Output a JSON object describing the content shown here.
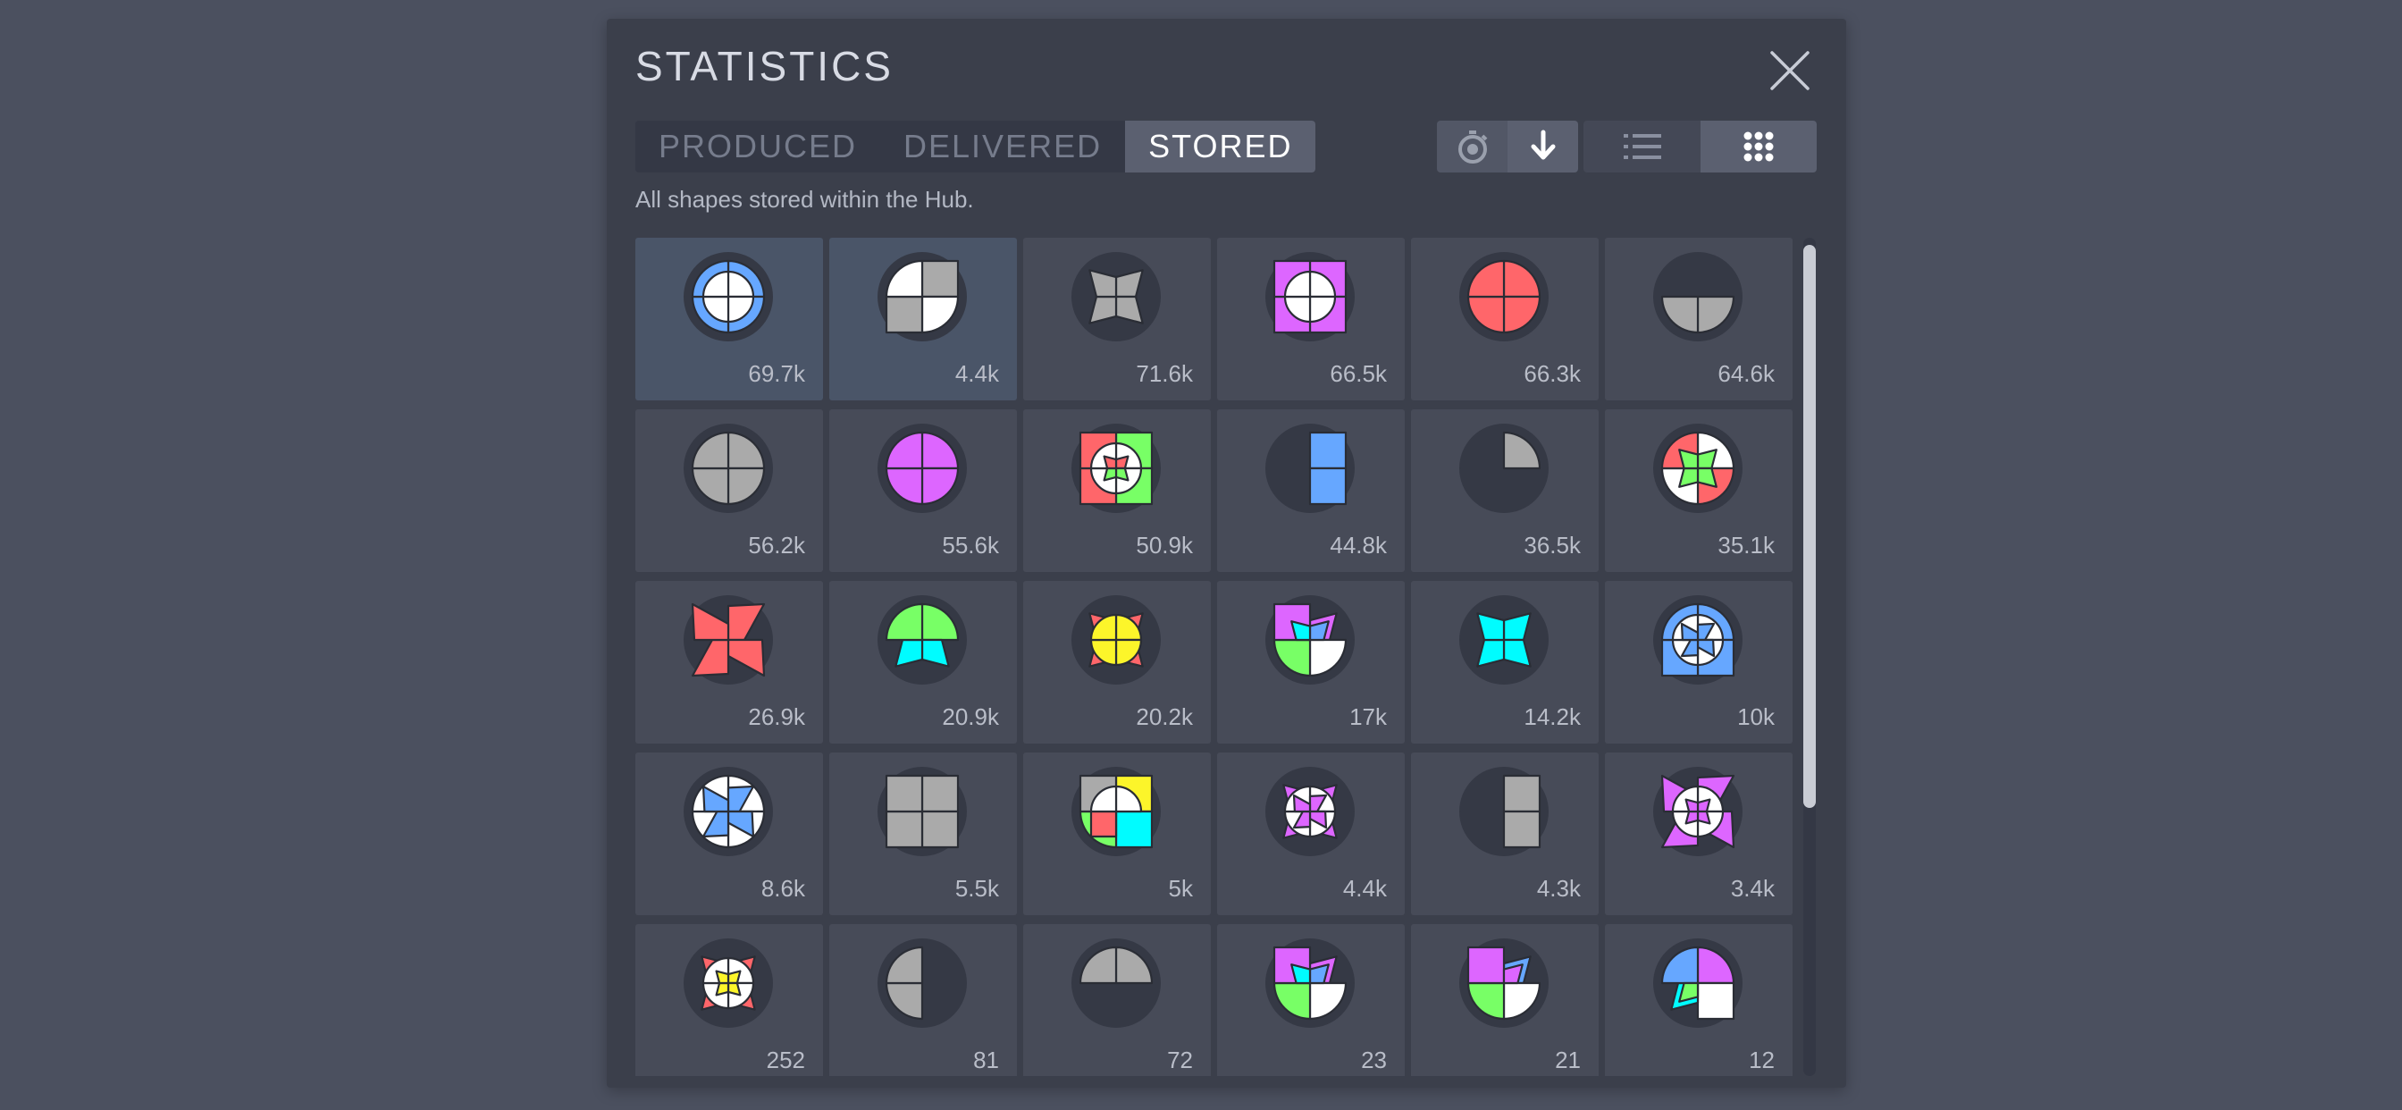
{
  "dialog": {
    "title": "STATISTICS",
    "subtitle": "All shapes stored within the Hub.",
    "tabs": [
      {
        "label": "PRODUCED",
        "active": false
      },
      {
        "label": "DELIVERED",
        "active": false
      },
      {
        "label": "STORED",
        "active": true
      }
    ],
    "mode_buttons": [
      {
        "name": "stopwatch-icon",
        "active": false
      },
      {
        "name": "arrow-down-icon",
        "active": true
      },
      {
        "name": "list-view-icon",
        "active": false
      },
      {
        "name": "grid-view-icon",
        "active": true
      }
    ]
  },
  "shapes": [
    {
      "count": "69.7k",
      "selected": true
    },
    {
      "count": "4.4k",
      "selected": true
    },
    {
      "count": "71.6k"
    },
    {
      "count": "66.5k"
    },
    {
      "count": "66.3k"
    },
    {
      "count": "64.6k"
    },
    {
      "count": "56.2k"
    },
    {
      "count": "55.6k"
    },
    {
      "count": "50.9k"
    },
    {
      "count": "44.8k"
    },
    {
      "count": "36.5k"
    },
    {
      "count": "35.1k"
    },
    {
      "count": "26.9k"
    },
    {
      "count": "20.9k"
    },
    {
      "count": "20.2k"
    },
    {
      "count": "17k"
    },
    {
      "count": "14.2k"
    },
    {
      "count": "10k"
    },
    {
      "count": "8.6k"
    },
    {
      "count": "5.5k"
    },
    {
      "count": "5k"
    },
    {
      "count": "4.4k"
    },
    {
      "count": "4.3k"
    },
    {
      "count": "3.4k"
    },
    {
      "count": "252"
    },
    {
      "count": "81"
    },
    {
      "count": "72"
    },
    {
      "count": "23"
    },
    {
      "count": "21"
    },
    {
      "count": "12"
    }
  ],
  "colors": {
    "blue": "#66a7ff",
    "red": "#ff666a",
    "green": "#78ff66",
    "purple": "#dd66ff",
    "yellow": "#fcf52a",
    "cyan": "#00fcff",
    "white": "#ffffff",
    "grey": "#aaaaaa"
  }
}
